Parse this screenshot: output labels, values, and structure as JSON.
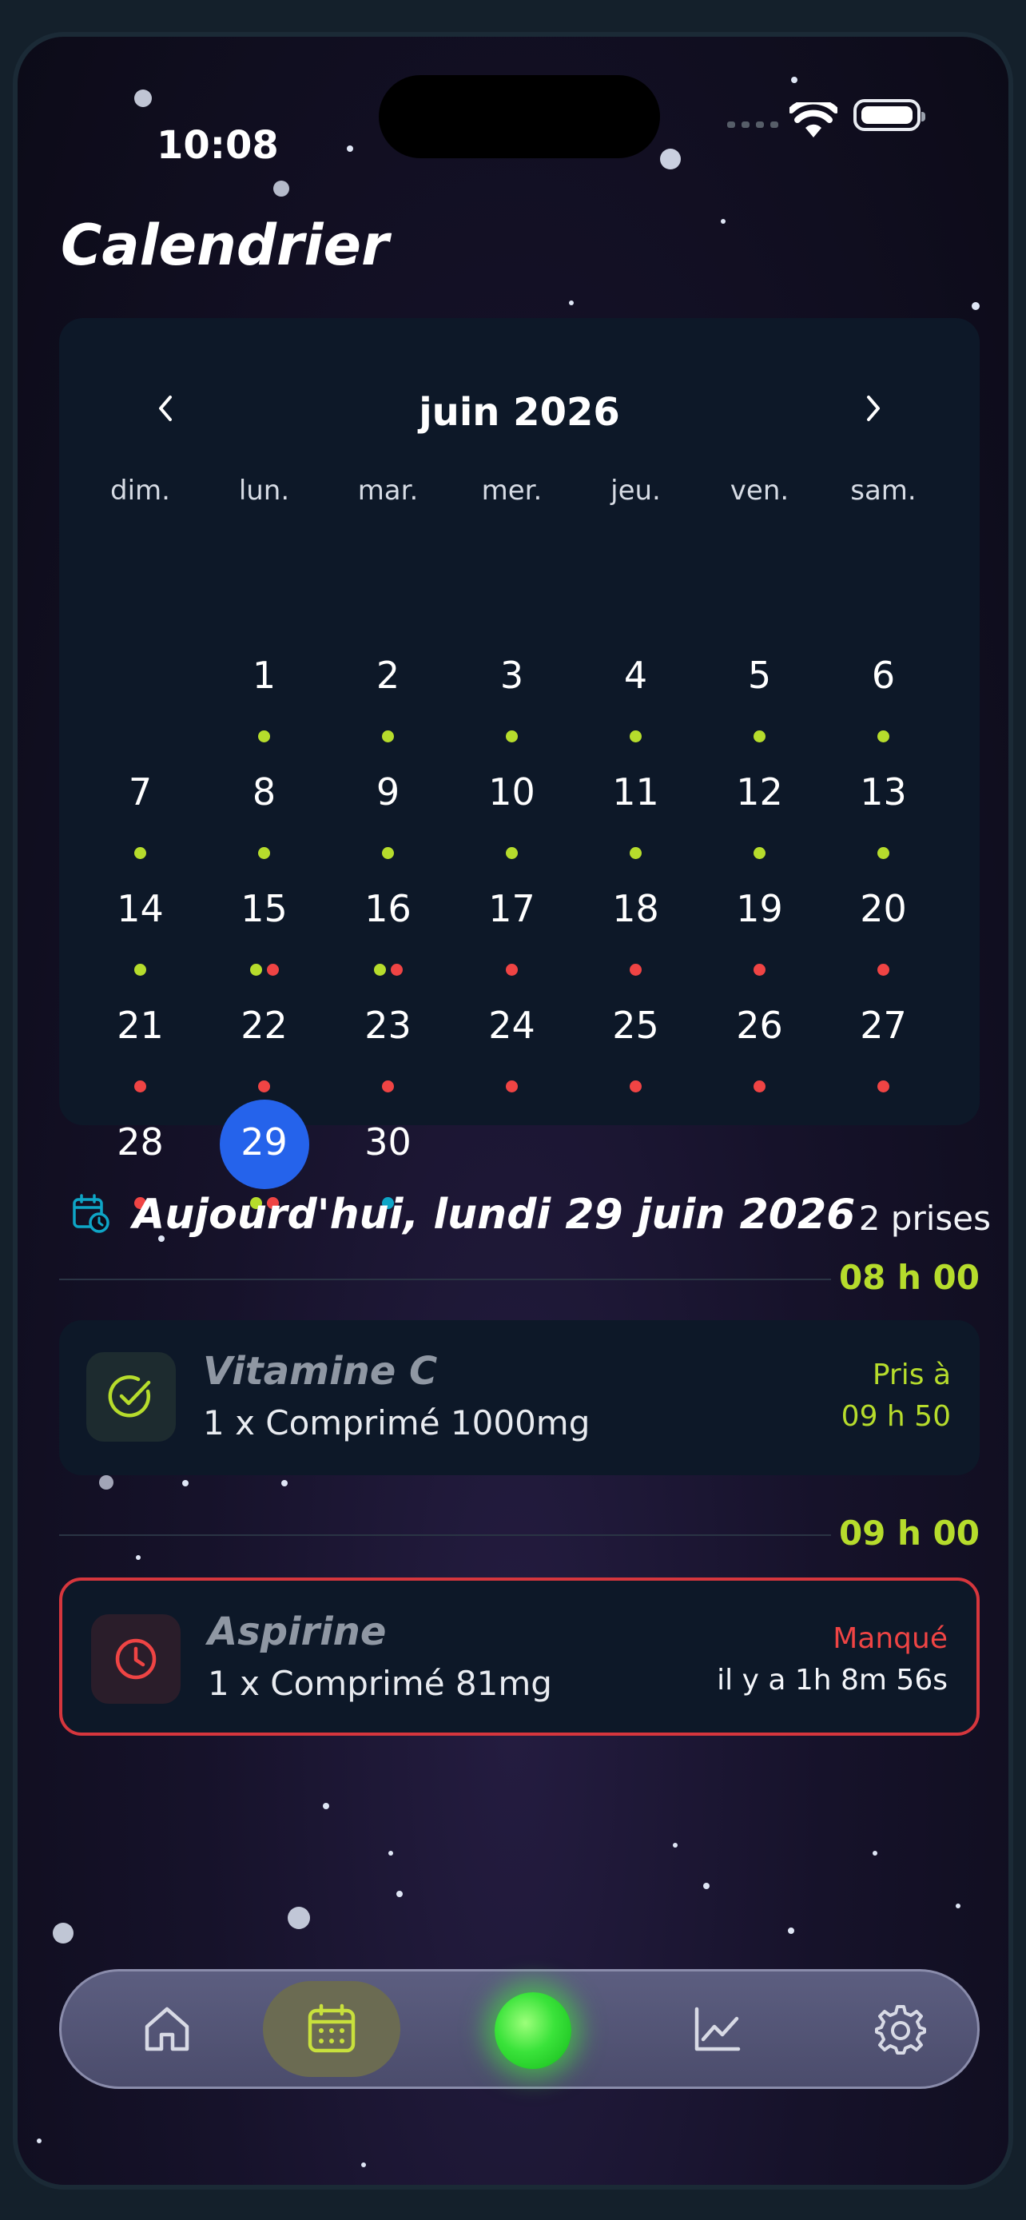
{
  "status_bar": {
    "time": "10:08"
  },
  "header": {
    "title": "Calendrier"
  },
  "calendar": {
    "month_label": "juin 2026",
    "weekdays": [
      "dim.",
      "lun.",
      "mar.",
      "mer.",
      "jeu.",
      "ven.",
      "sam."
    ],
    "today": "29",
    "days": [
      {
        "n": "1",
        "dots": [
          "green"
        ]
      },
      {
        "n": "2",
        "dots": [
          "green"
        ]
      },
      {
        "n": "3",
        "dots": [
          "green"
        ]
      },
      {
        "n": "4",
        "dots": [
          "green"
        ]
      },
      {
        "n": "5",
        "dots": [
          "green"
        ]
      },
      {
        "n": "6",
        "dots": [
          "green"
        ]
      },
      {
        "n": "7",
        "dots": [
          "green"
        ]
      },
      {
        "n": "8",
        "dots": [
          "green"
        ]
      },
      {
        "n": "9",
        "dots": [
          "green"
        ]
      },
      {
        "n": "10",
        "dots": [
          "green"
        ]
      },
      {
        "n": "11",
        "dots": [
          "green"
        ]
      },
      {
        "n": "12",
        "dots": [
          "green"
        ]
      },
      {
        "n": "13",
        "dots": [
          "green"
        ]
      },
      {
        "n": "14",
        "dots": [
          "green"
        ]
      },
      {
        "n": "15",
        "dots": [
          "green",
          "red"
        ]
      },
      {
        "n": "16",
        "dots": [
          "green",
          "red"
        ]
      },
      {
        "n": "17",
        "dots": [
          "red"
        ]
      },
      {
        "n": "18",
        "dots": [
          "red"
        ]
      },
      {
        "n": "19",
        "dots": [
          "red"
        ]
      },
      {
        "n": "20",
        "dots": [
          "red"
        ]
      },
      {
        "n": "21",
        "dots": [
          "red"
        ]
      },
      {
        "n": "22",
        "dots": [
          "red"
        ]
      },
      {
        "n": "23",
        "dots": [
          "red"
        ]
      },
      {
        "n": "24",
        "dots": [
          "red"
        ]
      },
      {
        "n": "25",
        "dots": [
          "red"
        ]
      },
      {
        "n": "26",
        "dots": [
          "red"
        ]
      },
      {
        "n": "27",
        "dots": [
          "red"
        ]
      },
      {
        "n": "28",
        "dots": [
          "red"
        ]
      },
      {
        "n": "29",
        "dots": [
          "green",
          "red"
        ]
      },
      {
        "n": "30",
        "dots": [
          "blue"
        ]
      }
    ]
  },
  "today_section": {
    "title": "Aujourd'hui, lundi 29 juin 2026",
    "count_label": "2 prises"
  },
  "doses": [
    {
      "time": "08 h 00",
      "name": "Vitamine C",
      "dose": "1 x Comprimé 1000mg",
      "status_line1": "Pris à",
      "status_line2": "09 h 50",
      "state": "taken",
      "icon": "check-circle-icon"
    },
    {
      "time": "09 h 00",
      "name": "Aspirine",
      "dose": "1 x Comprimé 81mg",
      "status_line1": "Manqué",
      "status_line2": "il y a 1h 8m 56s",
      "state": "missed",
      "icon": "clock-icon"
    }
  ],
  "tabbar": {
    "items": [
      "home-icon",
      "calendar-icon",
      "orb-icon",
      "chart-icon",
      "gear-icon"
    ],
    "active": "calendar-icon"
  },
  "colors": {
    "green": "#b6dc2c",
    "red": "#ef4444",
    "blue": "#0ea5c6",
    "today": "#2563eb",
    "card": "#0d1828"
  }
}
